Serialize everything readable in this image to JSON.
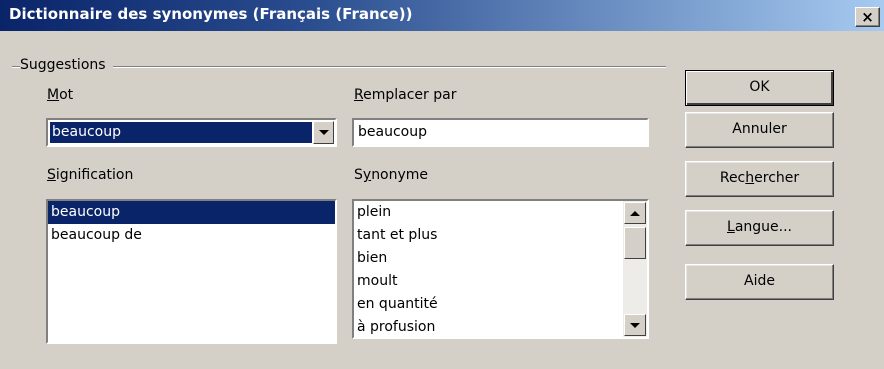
{
  "window": {
    "title": "Dictionnaire des synonymes (Français (France))",
    "close_glyph": "×"
  },
  "group": {
    "label": "Suggestions"
  },
  "word": {
    "label_accel": "M",
    "label_rest": "ot",
    "value": "beaucoup"
  },
  "replace": {
    "label_accel": "R",
    "label_rest": "emplacer par",
    "value": "beaucoup"
  },
  "meaning": {
    "label_accel": "S",
    "label_rest": "ignification",
    "items": [
      "beaucoup",
      "beaucoup de"
    ],
    "selected_index": 0
  },
  "synonym": {
    "label_pre": "S",
    "label_accel": "y",
    "label_rest": "nonyme",
    "items": [
      "plein",
      "tant et plus",
      "bien",
      "moult",
      "en quantité",
      "à profusion"
    ]
  },
  "buttons": {
    "ok": "OK",
    "cancel": "Annuler",
    "search_pre": "Rec",
    "search_accel": "h",
    "search_rest": "ercher",
    "language_accel": "L",
    "language_rest": "angue...",
    "help": "Aide"
  }
}
